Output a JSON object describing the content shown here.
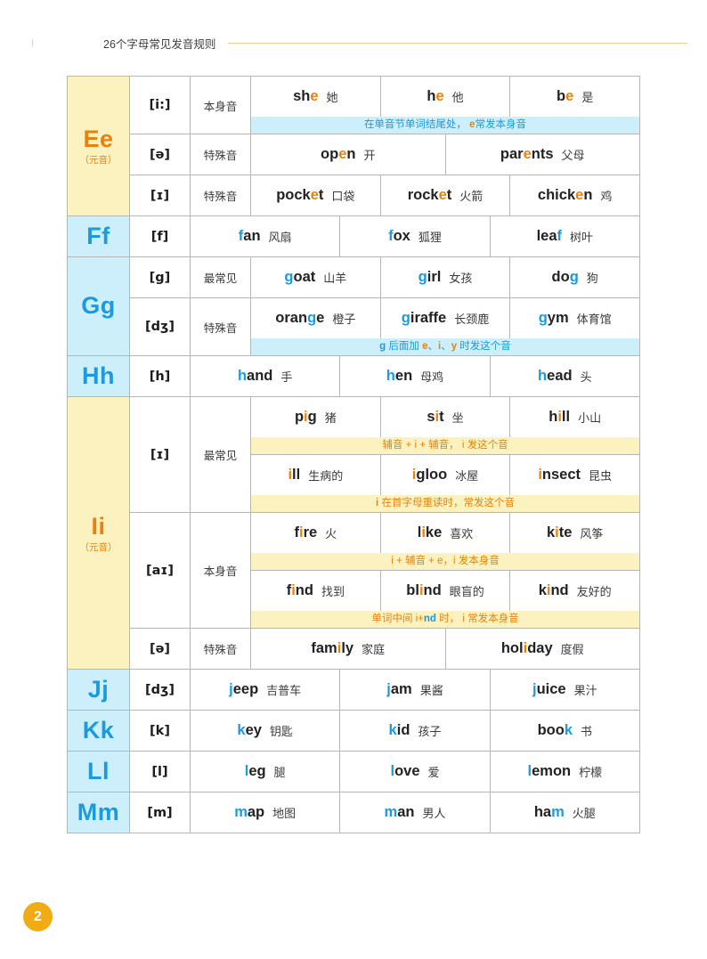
{
  "header": {
    "tick": "|",
    "title": "26个字母常见发音规则"
  },
  "page": {
    "number": "2"
  },
  "colors": {
    "vowel_bg": "#fbf2c0",
    "vowel_fg": "#e8820c",
    "consonant_bg": "#cdeefb",
    "consonant_fg": "#1b9ae0",
    "note_blue_bg": "#cdeefb",
    "note_yellow_bg": "#fbf2c0",
    "page_badge": "#f0ab15",
    "rule_line": "#f2c98a"
  },
  "labels": {
    "vowel_tag": "（元音）",
    "own_sound": "本身音",
    "special_sound": "特殊音",
    "most_common": "最常见"
  },
  "rows": [
    {
      "letter": "Ee",
      "kind": "vowel",
      "sub": "（元音）",
      "groups": [
        {
          "ipa": "[i:]",
          "type": "本身音",
          "blocks": [
            {
              "words": [
                {
                  "pre": "sh",
                  "hl": "e",
                  "post": "",
                  "cn": "她"
                },
                {
                  "pre": "h",
                  "hl": "e",
                  "post": "",
                  "cn": "他"
                },
                {
                  "pre": "b",
                  "hl": "e",
                  "post": "",
                  "cn": "是"
                }
              ],
              "note": {
                "style": "blue",
                "parts": [
                  {
                    "t": "在单音节单词结尾处，  ",
                    "c": "plain"
                  },
                  {
                    "t": "e",
                    "c": "orange"
                  },
                  {
                    "t": "常发本身音",
                    "c": "plain"
                  }
                ]
              }
            }
          ]
        },
        {
          "ipa": "[ə]",
          "type": "特殊音",
          "blocks": [
            {
              "words": [
                {
                  "pre": "op",
                  "hl": "e",
                  "post": "n",
                  "cn": "开"
                },
                {
                  "pre": "par",
                  "hl": "e",
                  "post": "nts",
                  "cn": "父母"
                }
              ],
              "note": null
            }
          ]
        },
        {
          "ipa": "[ɪ]",
          "type": "特殊音",
          "blocks": [
            {
              "words": [
                {
                  "pre": "pock",
                  "hl": "e",
                  "post": "t",
                  "cn": "口袋"
                },
                {
                  "pre": "rock",
                  "hl": "e",
                  "post": "t",
                  "cn": "火箭"
                },
                {
                  "pre": "chick",
                  "hl": "e",
                  "post": "n",
                  "cn": "鸡"
                }
              ],
              "note": null
            }
          ]
        }
      ]
    },
    {
      "letter": "Ff",
      "kind": "cons",
      "sub": "",
      "groups": [
        {
          "ipa": "[f]",
          "type": null,
          "blocks": [
            {
              "words": [
                {
                  "pre": "",
                  "hl": "f",
                  "post": "an",
                  "cn": "风扇"
                },
                {
                  "pre": "",
                  "hl": "f",
                  "post": "ox",
                  "cn": "狐狸"
                },
                {
                  "pre": "lea",
                  "hl": "f",
                  "post": "",
                  "cn": "树叶"
                }
              ],
              "note": null
            }
          ]
        }
      ]
    },
    {
      "letter": "Gg",
      "kind": "cons",
      "sub": "",
      "groups": [
        {
          "ipa": "[g]",
          "type": "最常见",
          "blocks": [
            {
              "words": [
                {
                  "pre": "",
                  "hl": "g",
                  "post": "oat",
                  "cn": "山羊"
                },
                {
                  "pre": "",
                  "hl": "g",
                  "post": "irl",
                  "cn": "女孩"
                },
                {
                  "pre": "do",
                  "hl": "g",
                  "post": "",
                  "cn": "狗"
                }
              ],
              "note": null
            }
          ]
        },
        {
          "ipa": "[dʒ]",
          "type": "特殊音",
          "blocks": [
            {
              "words": [
                {
                  "pre": "oran",
                  "hl": "g",
                  "post": "e",
                  "cn": "橙子"
                },
                {
                  "pre": "",
                  "hl": "g",
                  "post": "iraffe",
                  "cn": "长颈鹿"
                },
                {
                  "pre": "",
                  "hl": "g",
                  "post": "ym",
                  "cn": "体育馆"
                }
              ],
              "note": {
                "style": "blue",
                "parts": [
                  {
                    "t": "g",
                    "c": "blue"
                  },
                  {
                    "t": " 后面加 ",
                    "c": "plain"
                  },
                  {
                    "t": "e",
                    "c": "orange"
                  },
                  {
                    "t": "、",
                    "c": "plain"
                  },
                  {
                    "t": "i",
                    "c": "orange"
                  },
                  {
                    "t": "、",
                    "c": "plain"
                  },
                  {
                    "t": "y",
                    "c": "orange"
                  },
                  {
                    "t": " 时发这个音",
                    "c": "plain"
                  }
                ]
              }
            }
          ]
        }
      ]
    },
    {
      "letter": "Hh",
      "kind": "cons",
      "sub": "",
      "groups": [
        {
          "ipa": "[h]",
          "type": null,
          "blocks": [
            {
              "words": [
                {
                  "pre": "",
                  "hl": "h",
                  "post": "and",
                  "cn": "手"
                },
                {
                  "pre": "",
                  "hl": "h",
                  "post": "en",
                  "cn": "母鸡"
                },
                {
                  "pre": "",
                  "hl": "h",
                  "post": "ead",
                  "cn": "头"
                }
              ],
              "note": null
            }
          ]
        }
      ]
    },
    {
      "letter": "Ii",
      "kind": "vowel",
      "sub": "（元音）",
      "groups": [
        {
          "ipa": "[ɪ]",
          "type": "最常见",
          "blocks": [
            {
              "words": [
                {
                  "pre": "p",
                  "hl": "i",
                  "post": "g",
                  "cn": "猪"
                },
                {
                  "pre": "s",
                  "hl": "i",
                  "post": "t",
                  "cn": "坐"
                },
                {
                  "pre": "h",
                  "hl": "i",
                  "post": "ll",
                  "cn": "小山"
                }
              ],
              "note": {
                "style": "yellow",
                "parts": [
                  {
                    "t": "辅音 + i + 辅音，  i 发这个音",
                    "c": "plain"
                  }
                ]
              }
            },
            {
              "words": [
                {
                  "pre": "",
                  "hl": "i",
                  "post": "ll",
                  "cn": "生病的"
                },
                {
                  "pre": "",
                  "hl": "i",
                  "post": "gloo",
                  "cn": "冰屋"
                },
                {
                  "pre": "",
                  "hl": "i",
                  "post": "nsect",
                  "cn": "昆虫"
                }
              ],
              "note": {
                "style": "yellow",
                "parts": [
                  {
                    "t": "i",
                    "c": "orange"
                  },
                  {
                    "t": " 在首字母重读时，常发这个音",
                    "c": "plain"
                  }
                ]
              }
            }
          ]
        },
        {
          "ipa": "[aɪ]",
          "type": "本身音",
          "blocks": [
            {
              "words": [
                {
                  "pre": "f",
                  "hl": "i",
                  "post": "re",
                  "cn": "火"
                },
                {
                  "pre": "l",
                  "hl": "i",
                  "post": "ke",
                  "cn": "喜欢"
                },
                {
                  "pre": "k",
                  "hl": "i",
                  "post": "te",
                  "cn": "风筝"
                }
              ],
              "note": {
                "style": "yellow",
                "parts": [
                  {
                    "t": "i + 辅音 + e，i 发本身音",
                    "c": "plain"
                  }
                ]
              }
            },
            {
              "words": [
                {
                  "pre": "f",
                  "hl": "i",
                  "post": "nd",
                  "cn": "找到"
                },
                {
                  "pre": "bl",
                  "hl": "i",
                  "post": "nd",
                  "cn": "眼盲的"
                },
                {
                  "pre": "k",
                  "hl": "i",
                  "post": "nd",
                  "cn": "友好的"
                }
              ],
              "note": {
                "style": "yellow",
                "parts": [
                  {
                    "t": "单词中间 i+",
                    "c": "plain"
                  },
                  {
                    "t": "nd",
                    "c": "blue"
                  },
                  {
                    "t": " 时， i 常发本身音",
                    "c": "plain"
                  }
                ]
              }
            }
          ]
        },
        {
          "ipa": "[ə]",
          "type": "特殊音",
          "blocks": [
            {
              "words": [
                {
                  "pre": "fam",
                  "hl": "i",
                  "post": "ly",
                  "cn": "家庭"
                },
                {
                  "pre": "hol",
                  "hl": "i",
                  "post": "day",
                  "cn": "度假"
                }
              ],
              "note": null
            }
          ]
        }
      ]
    },
    {
      "letter": "Jj",
      "kind": "cons",
      "sub": "",
      "groups": [
        {
          "ipa": "[dʒ]",
          "type": null,
          "blocks": [
            {
              "words": [
                {
                  "pre": "",
                  "hl": "j",
                  "post": "eep",
                  "cn": "吉普车"
                },
                {
                  "pre": "",
                  "hl": "j",
                  "post": "am",
                  "cn": "果酱"
                },
                {
                  "pre": "",
                  "hl": "j",
                  "post": "uice",
                  "cn": "果汁"
                }
              ],
              "note": null
            }
          ]
        }
      ]
    },
    {
      "letter": "Kk",
      "kind": "cons",
      "sub": "",
      "groups": [
        {
          "ipa": "[k]",
          "type": null,
          "blocks": [
            {
              "words": [
                {
                  "pre": "",
                  "hl": "k",
                  "post": "ey",
                  "cn": "钥匙"
                },
                {
                  "pre": "",
                  "hl": "k",
                  "post": "id",
                  "cn": "孩子"
                },
                {
                  "pre": "boo",
                  "hl": "k",
                  "post": "",
                  "cn": "书"
                }
              ],
              "note": null
            }
          ]
        }
      ]
    },
    {
      "letter": "Ll",
      "kind": "cons",
      "sub": "",
      "groups": [
        {
          "ipa": "[l]",
          "type": null,
          "blocks": [
            {
              "words": [
                {
                  "pre": "",
                  "hl": "l",
                  "post": "eg",
                  "cn": "腿"
                },
                {
                  "pre": "",
                  "hl": "l",
                  "post": "ove",
                  "cn": "爱"
                },
                {
                  "pre": "",
                  "hl": "l",
                  "post": "emon",
                  "cn": "柠檬"
                }
              ],
              "note": null
            }
          ]
        }
      ]
    },
    {
      "letter": "Mm",
      "kind": "cons",
      "sub": "",
      "groups": [
        {
          "ipa": "[m]",
          "type": null,
          "blocks": [
            {
              "words": [
                {
                  "pre": "",
                  "hl": "m",
                  "post": "ap",
                  "cn": "地图"
                },
                {
                  "pre": "",
                  "hl": "m",
                  "post": "an",
                  "cn": "男人"
                },
                {
                  "pre": "ha",
                  "hl": "m",
                  "post": "",
                  "cn": "火腿"
                }
              ],
              "note": null
            }
          ]
        }
      ]
    }
  ]
}
